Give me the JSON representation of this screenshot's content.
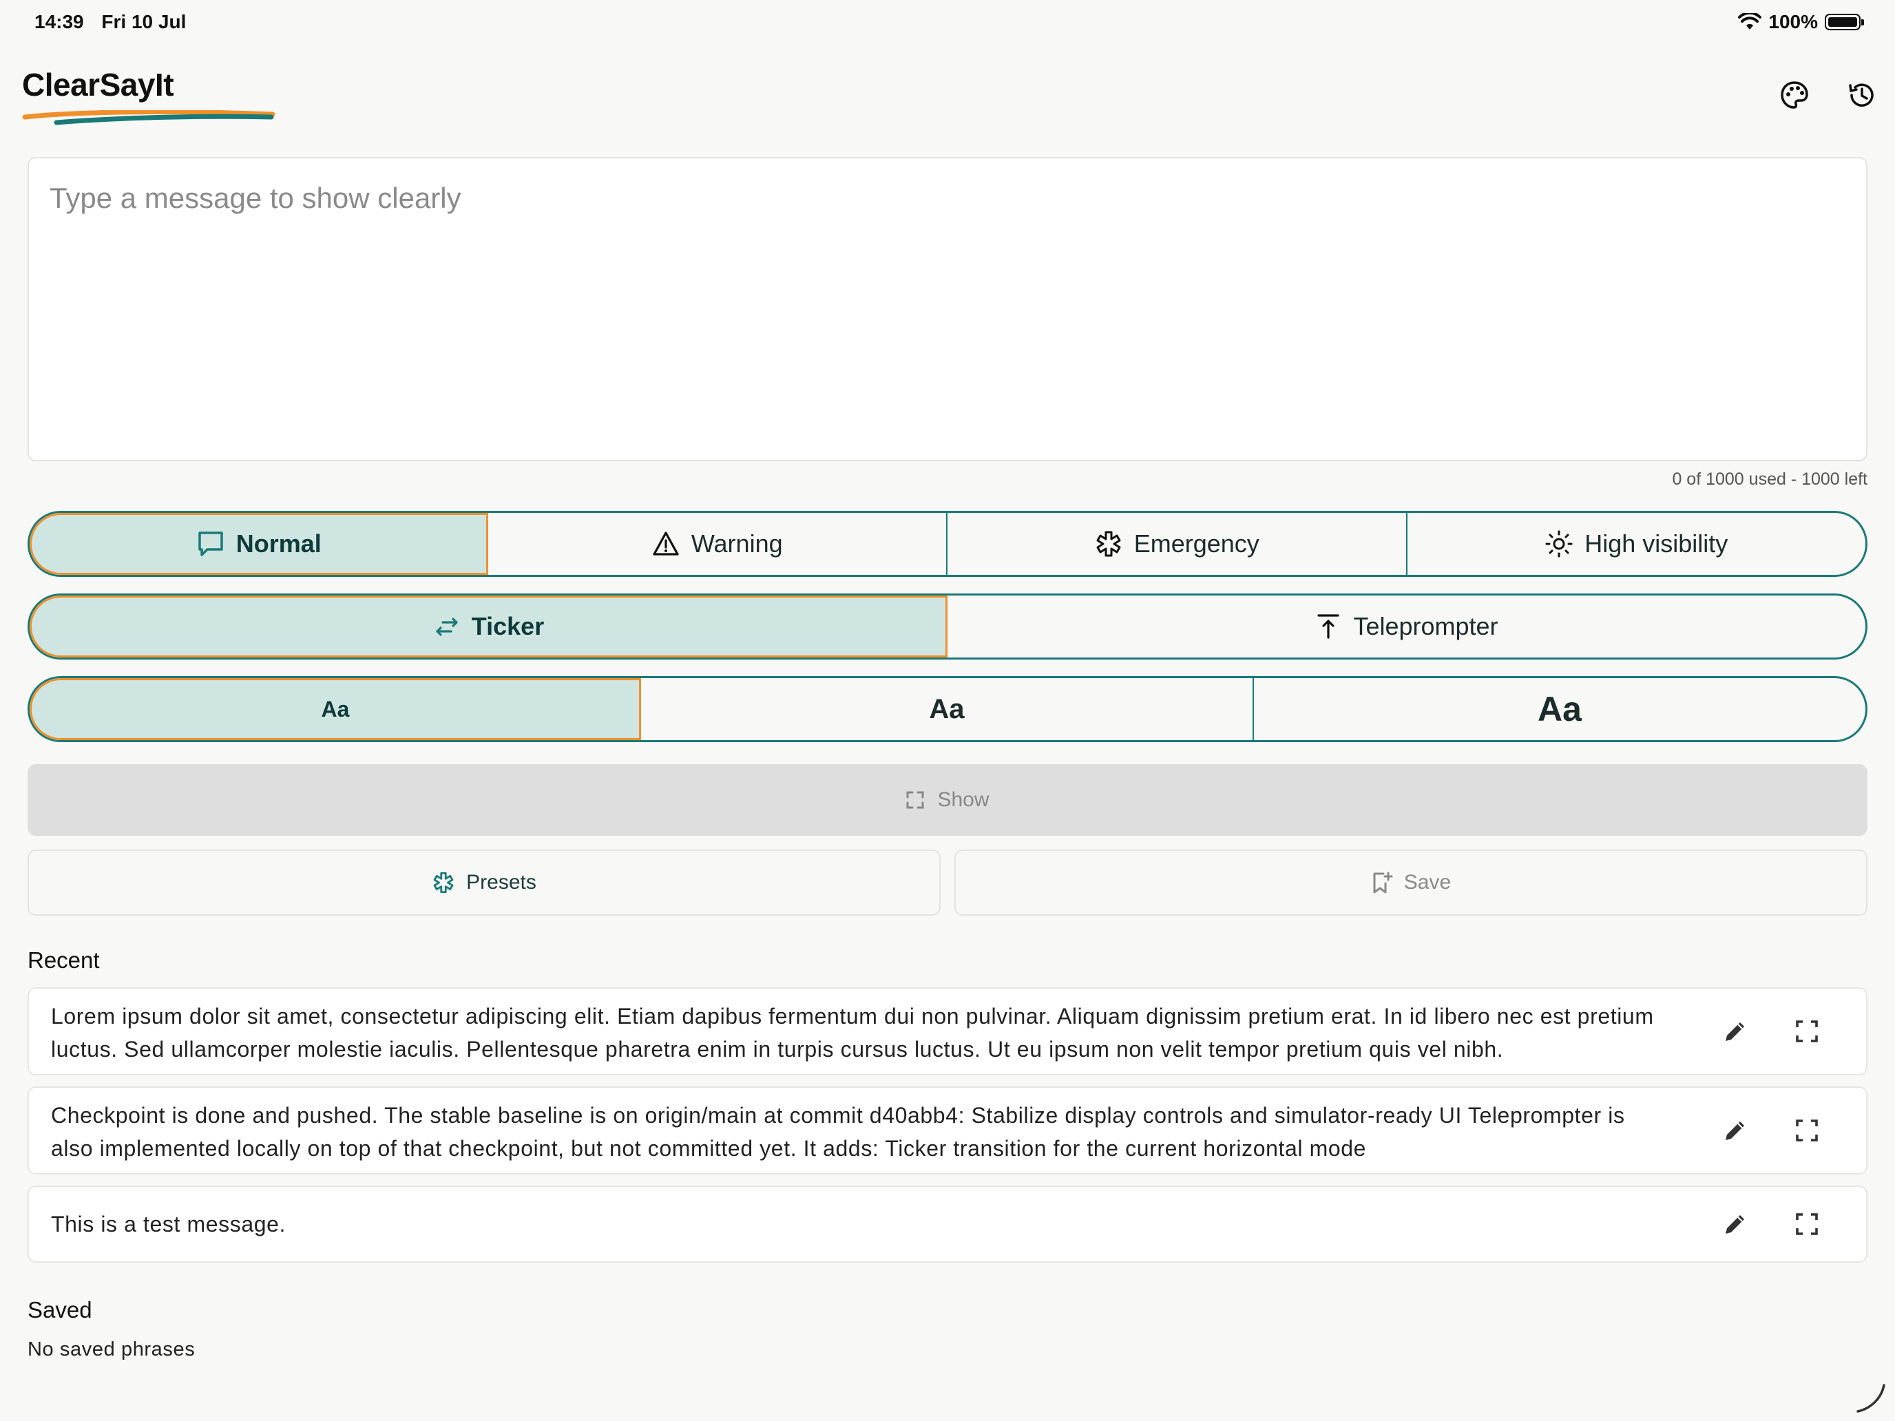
{
  "status_bar": {
    "time": "14:39",
    "date": "Fri 10 Jul",
    "battery": "100%"
  },
  "app": {
    "title": "ClearSayIt",
    "accent_orange": "#f0902a",
    "accent_teal": "#1a7a78"
  },
  "editor": {
    "placeholder": "Type a message to show clearly",
    "value": "",
    "counter": "0 of 1000 used - 1000 left"
  },
  "styles": {
    "options": [
      {
        "label": "Normal",
        "icon": "chat-bubble-icon",
        "selected": true
      },
      {
        "label": "Warning",
        "icon": "warning-triangle-icon",
        "selected": false
      },
      {
        "label": "Emergency",
        "icon": "asterisk-icon",
        "selected": false
      },
      {
        "label": "High visibility",
        "icon": "sun-icon",
        "selected": false
      }
    ]
  },
  "display_modes": {
    "options": [
      {
        "label": "Ticker",
        "icon": "swap-arrows-icon",
        "selected": true
      },
      {
        "label": "Teleprompter",
        "icon": "arrow-up-to-line-icon",
        "selected": false
      }
    ]
  },
  "text_sizes": {
    "options": [
      {
        "label": "Aa",
        "selected": true
      },
      {
        "label": "Aa",
        "selected": false
      },
      {
        "label": "Aa",
        "selected": false
      }
    ]
  },
  "actions": {
    "show_label": "Show",
    "presets_label": "Presets",
    "save_label": "Save"
  },
  "recent": {
    "heading": "Recent",
    "items": [
      {
        "text": "Lorem ipsum dolor sit amet, consectetur adipiscing elit. Etiam dapibus fermentum dui non pulvinar. Aliquam dignissim pretium erat. In id libero nec est pretium luctus. Sed ullamcorper molestie iaculis. Pellentesque pharetra enim in turpis cursus luctus. Ut eu ipsum non velit tempor pretium quis vel nibh."
      },
      {
        "text": "Checkpoint is done and pushed. The stable baseline is on origin/main at commit d40abb4: Stabilize display controls and simulator-ready UI Teleprompter is also implemented locally on top of that checkpoint, but not committed yet. It adds: Ticker transition for the current horizontal mode"
      },
      {
        "text": "This is a test message."
      }
    ]
  },
  "saved": {
    "heading": "Saved",
    "empty_text": "No saved phrases"
  }
}
